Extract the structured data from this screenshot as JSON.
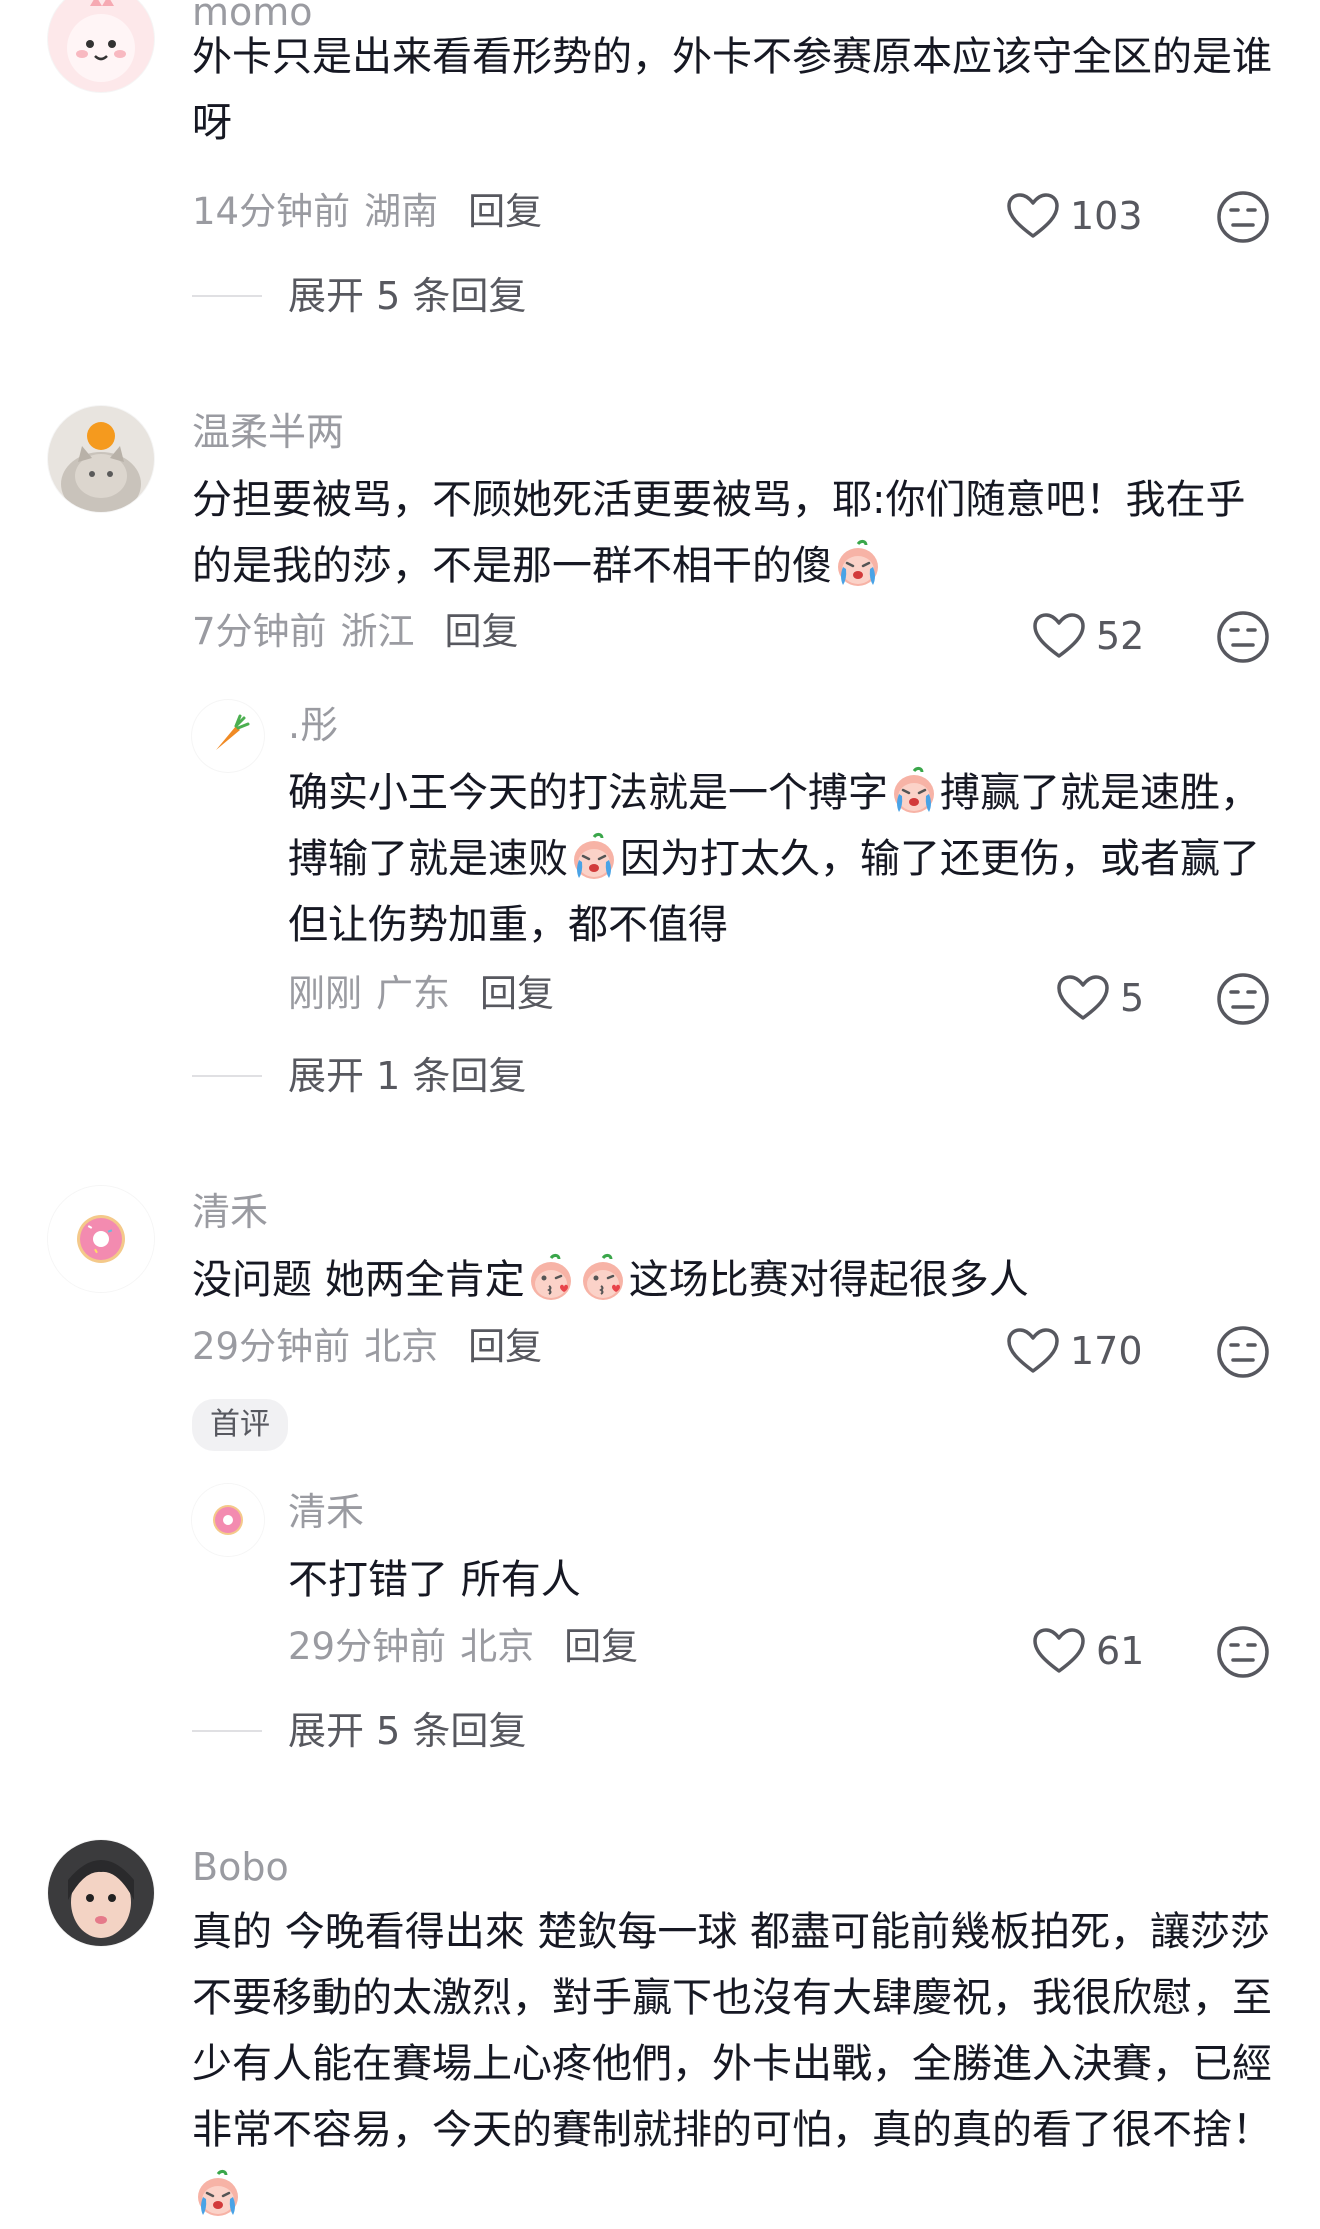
{
  "comments": [
    {
      "username": "momo",
      "text": "外卡只是出来看看形势的，外卡不参赛原本应该守全区的是谁呀",
      "time": "14分钟前",
      "location": "湖南",
      "reply_label": "回复",
      "likes": "103",
      "expand_label": "展开 5 条回复"
    },
    {
      "username": "温柔半两",
      "text": "分担要被骂，不顾她死活更要被骂，耶:你们随意吧！我在乎的是我的莎，不是那一群不相干的傻",
      "time": "7分钟前",
      "location": "浙江",
      "reply_label": "回复",
      "likes": "52",
      "reply": {
        "username": ".彤",
        "text_1": "确实小王今天的打法就是一个搏字",
        "text_2": "搏赢了就是速胜，搏输了就是速败",
        "text_3": "因为打太久，输了还更伤，或者赢了但让伤势加重，都不值得",
        "time": "刚刚",
        "location": "广东",
        "reply_label": "回复",
        "likes": "5"
      },
      "expand_label": "展开 1 条回复"
    },
    {
      "username": "清禾",
      "text_1": "没问题 她两全肯定",
      "text_2": "这场比赛对得起很多人",
      "time": "29分钟前",
      "location": "北京",
      "reply_label": "回复",
      "likes": "170",
      "badge": "首评",
      "reply": {
        "username": "清禾",
        "text": "不打错了 所有人",
        "time": "29分钟前",
        "location": "北京",
        "reply_label": "回复",
        "likes": "61"
      },
      "expand_label": "展开 5 条回复"
    },
    {
      "username": "Bobo",
      "text": "真的 今晚看得出來 楚欽每一球 都盡可能前幾板拍死，讓莎莎不要移動的太激烈，對手贏下也沒有大肆慶祝，我很欣慰，至少有人能在賽場上心疼他們，外卡出戰，全勝進入決賽，已經非常不容易，今天的賽制就排的可怕，真的真的看了很不捨！"
    }
  ],
  "icons": {
    "like": "heart-outline-icon",
    "dislike": "meh-face-icon",
    "emoji_crying": "crying-peach-emoji",
    "emoji_kiss": "kissing-peach-emoji"
  }
}
